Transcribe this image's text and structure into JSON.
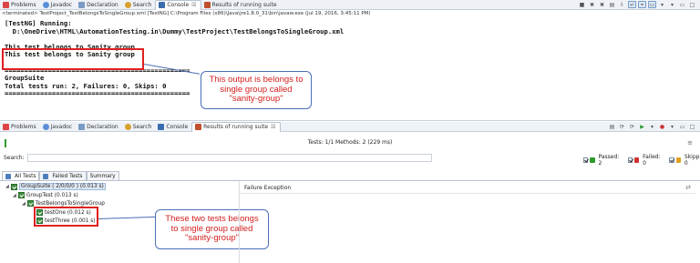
{
  "console_view": {
    "tabs": [
      {
        "label": "Problems",
        "icon_color": "#d44"
      },
      {
        "label": "Javadoc",
        "icon_color": "#5a8fd6"
      },
      {
        "label": "Declaration",
        "icon_color": "#7a9bc4"
      },
      {
        "label": "Search",
        "icon_color": "#d8a030"
      },
      {
        "label": "Console",
        "icon_color": "#3a6cb0",
        "close": "☒"
      },
      {
        "label": "Results of running suite",
        "icon_color": "#c0502c"
      }
    ],
    "terminated": "<terminated> TestProject_TestBelongsToSingleGroup.xml [TestNG] C:\\Program Files (x86)\\Java\\jre1.8.0_31\\bin\\javaw.exe (Jul 19, 2016, 3:45:11 PM)",
    "output": {
      "line1": "[TestNG] Running:",
      "line2": "  D:\\OneDrive\\HTML\\AutomationTesting.in\\Dummy\\TestProject\\TestBelongsToSingleGroup.xml",
      "line3": "",
      "line4": "This test belongs to Sanity group",
      "line5": "This test belongs to Sanity group",
      "line6": "",
      "line7": "===============================================",
      "line8": "GroupSuite",
      "line9": "Total tests run: 2, Failures: 0, Skips: 0",
      "line10": "==============================================="
    }
  },
  "callouts": {
    "top": "This output is belongs to single group called \"sanity-group\"",
    "bottom": "These two tests belongs to single group called \"sanity-group\""
  },
  "results_view": {
    "tabs": [
      {
        "label": "Problems",
        "icon_color": "#d44"
      },
      {
        "label": "Javadoc",
        "icon_color": "#5a8fd6"
      },
      {
        "label": "Declaration",
        "icon_color": "#7a9bc4"
      },
      {
        "label": "Search",
        "icon_color": "#d8a030"
      },
      {
        "label": "Console",
        "icon_color": "#3a6cb0"
      },
      {
        "label": "Results of running suite",
        "icon_color": "#c0502c",
        "close": "☒"
      }
    ],
    "summary": "Tests: 1/1  Methods: 2 (229 ms)",
    "search_label": "Search:",
    "search_value": "",
    "filters": [
      {
        "label": "Passed: 2",
        "color": "#2e9a2e"
      },
      {
        "label": "Failed: 0",
        "color": "#d03030"
      },
      {
        "label": "Skipped: 0",
        "color": "#e0a020"
      }
    ],
    "subtabs": [
      "All Tests",
      "Failed Tests",
      "Summary"
    ],
    "tree": {
      "suite": "GroupSuite ( 2/0/0/0 ) (0.013 s)",
      "test": "GroupTest (0.013 s)",
      "class": "TestBelongsToSingleGroup",
      "methods": [
        "testOne  (0.012 s)",
        "testThree  (0.001 s)"
      ]
    },
    "failure_title": "Failure Exception"
  }
}
